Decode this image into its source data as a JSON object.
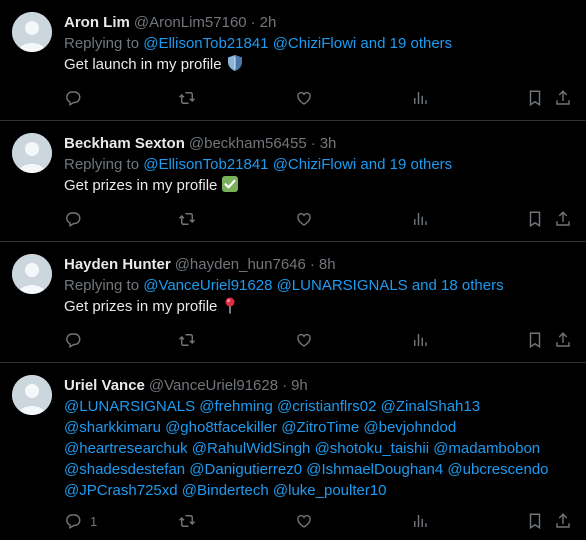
{
  "tweets": [
    {
      "name": "Aron Lim",
      "handle": "@AronLim57160",
      "time": "2h",
      "replying_prefix": "Replying to",
      "replying_links": "@EllisonTob21841 @ChiziFlowi and 19 others",
      "text": "Get launch in my profile",
      "emoji": "shield-icon",
      "reply_count": ""
    },
    {
      "name": "Beckham Sexton",
      "handle": "@beckham56455",
      "time": "3h",
      "replying_prefix": "Replying to",
      "replying_links": "@EllisonTob21841 @ChiziFlowi and 19 others",
      "text": "Get prizes in my profile",
      "emoji": "check-mark-icon",
      "reply_count": ""
    },
    {
      "name": "Hayden Hunter",
      "handle": "@hayden_hun7646",
      "time": "8h",
      "replying_prefix": "Replying to",
      "replying_links": "@VanceUriel91628 @LUNARSIGNALS and 18 others",
      "text": "Get prizes in my profile",
      "emoji": "pin-icon",
      "reply_count": ""
    },
    {
      "name": "Uriel Vance",
      "handle": "@VanceUriel91628",
      "time": "9h",
      "text": "@LUNARSIGNALS @frehming @cristianflrs02 @ZinalShah13 @sharkkimaru @gho8tfacekiller @ZitroTime @bevjohndod @heartresearchuk @RahulWidSingh @shotoku_taishii @madambobon @shadesdestefan @Danigutierrez0 @IshmaelDoughan4 @ubcrescendo @JPCrash725xd @Bindertech @luke_poulter10",
      "reply_count": "1"
    }
  ],
  "separator": "·",
  "colors": {
    "background": "#000000",
    "text": "#e7e9ea",
    "muted": "#71767b",
    "link": "#1d9bf0",
    "border": "#2f3336"
  }
}
